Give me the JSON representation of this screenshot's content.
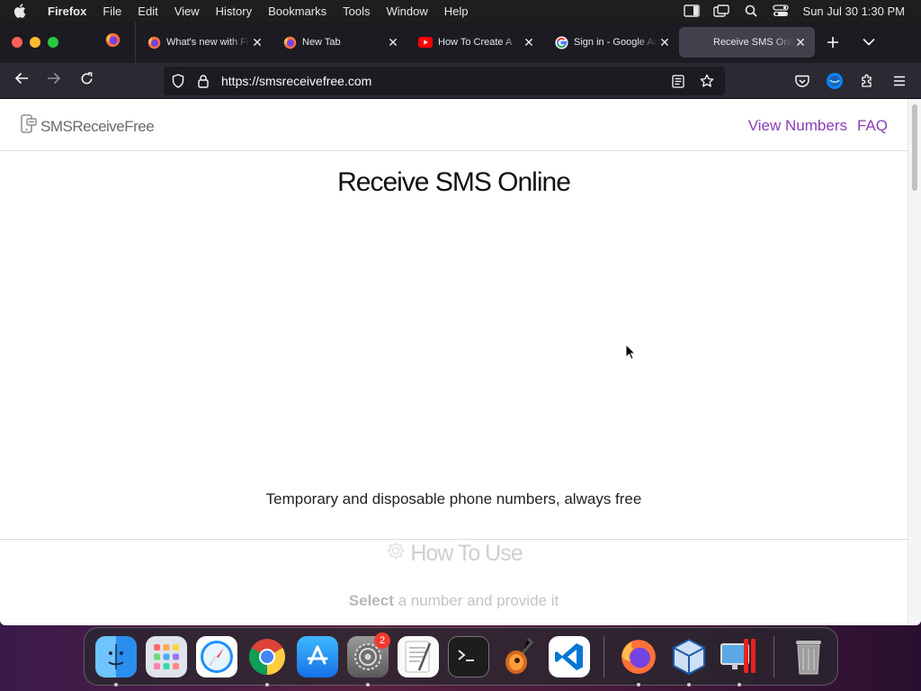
{
  "menubar": {
    "app_name": "Firefox",
    "menus": [
      "File",
      "Edit",
      "View",
      "History",
      "Bookmarks",
      "Tools",
      "Window",
      "Help"
    ],
    "clock": "Sun Jul 30  1:30 PM"
  },
  "tabs": [
    {
      "title": "What's new with Firefox",
      "icon": "firefox-icon"
    },
    {
      "title": "New Tab",
      "icon": "firefox-icon"
    },
    {
      "title": "How To Create A",
      "icon": "youtube-icon"
    },
    {
      "title": "Sign in - Google Accounts",
      "icon": "google-icon"
    },
    {
      "title": "Receive SMS Online",
      "icon": "site-icon",
      "active": true
    }
  ],
  "urlbar": {
    "url": "https://smsreceivefree.com"
  },
  "page": {
    "logo_text": "SMSReceiveFree",
    "nav": [
      "View Numbers",
      "FAQ"
    ],
    "hero_title": "Receive SMS Online",
    "tagline": "Temporary and disposable phone numbers, always free",
    "howto_title": "How To Use",
    "howto_step_bold": "Select",
    "howto_step_rest": " a number and provide it"
  },
  "dock": {
    "apps": [
      "finder",
      "launchpad",
      "safari",
      "chrome",
      "app-store",
      "system-settings",
      "textedit",
      "terminal",
      "garageband",
      "vscode",
      "firefox",
      "virtualbox",
      "parallels",
      "trash"
    ],
    "system_settings_badge": "2"
  },
  "colors": {
    "site_accent": "#8a3fb5",
    "menubar_bg": "#1e1e1e",
    "tabstrip_bg": "#1c1b22",
    "navbar_bg": "#2b2a33"
  }
}
